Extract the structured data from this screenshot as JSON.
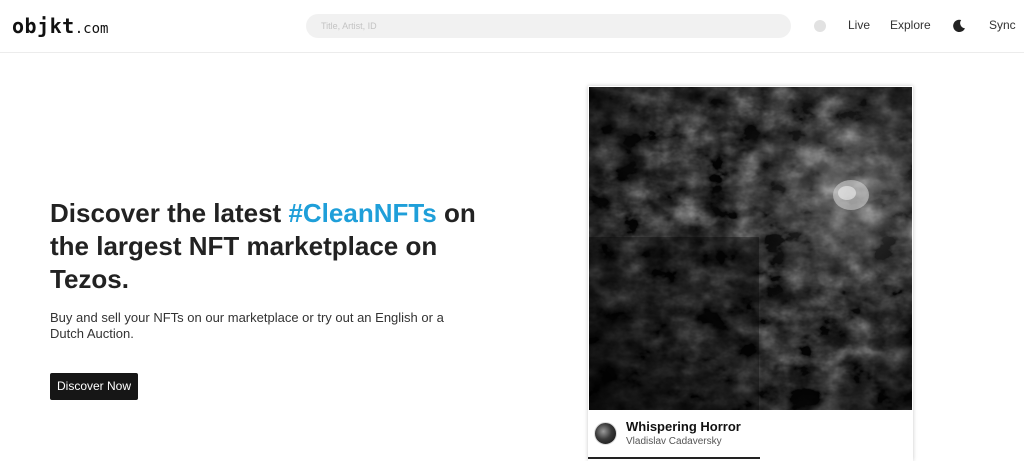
{
  "header": {
    "logo_main": "objkt",
    "logo_suffix": ".com",
    "search_placeholder": "Title, Artist, ID",
    "nav": {
      "live": "Live",
      "explore": "Explore",
      "sync": "Sync"
    },
    "icons": {
      "status": "status-dot-icon",
      "theme": "moon-icon"
    }
  },
  "hero": {
    "title_part1": "Discover the latest ",
    "title_highlight": "#CleanNFTs",
    "title_part2": " on the largest NFT marketplace on Tezos.",
    "subtitle": "Buy and sell your NFTs on our marketplace or try out an English or a Dutch Auction.",
    "cta_label": "Discover Now"
  },
  "featured": {
    "title": "Whispering Horror",
    "artist": "Vladislav Cadaversky",
    "slide_progress": 0.53
  },
  "colors": {
    "accent": "#1f9fd9",
    "button_bg": "#161616",
    "search_bg": "#f1f1f1"
  }
}
